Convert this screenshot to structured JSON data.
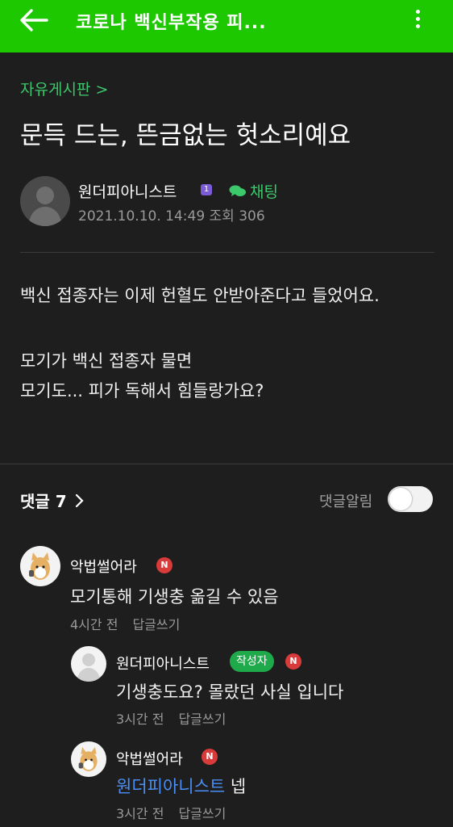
{
  "topbar": {
    "title": "코로나 백신부작용 피...",
    "accent": "#1ec800",
    "back_icon": "arrow-left-icon",
    "more_icon": "vertical-dots-icon"
  },
  "post": {
    "board": "자유게시판 >",
    "title": "문득 드는, 뜬금없는 헛소리예요",
    "author": "원더피아니스트",
    "level_badge": "1",
    "chat_label": "채팅",
    "meta": "2021.10.10. 14:49  조회 306",
    "body": [
      "백신 접종자는 이제 헌혈도 안받아준다고 들었어요.",
      "모기가 백신 접종자 물면",
      "모기도... 피가 독해서 힘들랑가요?"
    ]
  },
  "comments_section": {
    "label": "댓글 7",
    "chevron": ">",
    "notify_label": "댓글알림",
    "notify_on": false
  },
  "comments": [
    {
      "name": "악법썰어라",
      "badge": "N",
      "text": "모기통해 기생충 옮길 수 있음",
      "time": "4시간 전",
      "reply": "답글쓰기"
    },
    {
      "name": "원더피아니스트",
      "author_tag": "작성자",
      "badge": "N",
      "text": "기생충도요? 몰랐던 사실 입니다",
      "time": "3시간 전",
      "reply": "답글쓰기"
    },
    {
      "name": "악법썰어라",
      "badge": "N",
      "mention": "원더피아니스트",
      "text": " 넵",
      "time": "3시간 전",
      "reply": "답글쓰기"
    }
  ]
}
